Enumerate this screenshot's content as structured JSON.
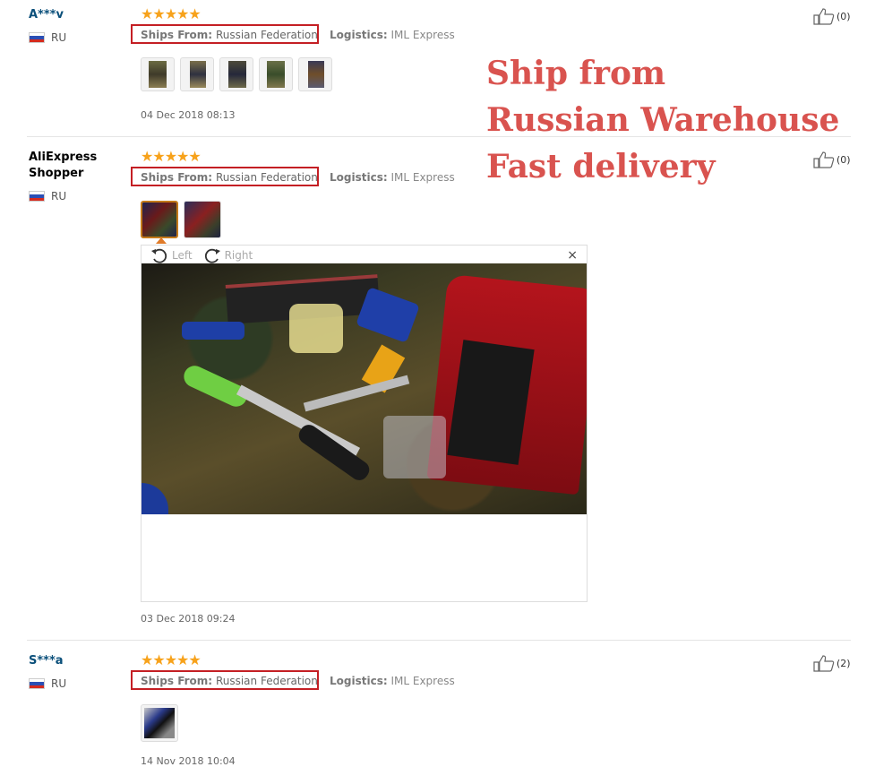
{
  "promo": {
    "line1": "Ship from",
    "line2": "Russian Warehouse",
    "line3": "Fast delivery"
  },
  "labels": {
    "ships_from": "Ships From:",
    "logistics": "Logistics:"
  },
  "viewer": {
    "rotate_left": "Left",
    "rotate_right": "Right",
    "close": "×"
  },
  "reviews": [
    {
      "user": "A***v",
      "country": "RU",
      "stars": "★★★★★",
      "ships_from": "Russian Federation",
      "logistics": "IML Express",
      "likes": "(0)",
      "date": "04 Dec 2018 08:13",
      "photo_count": 5
    },
    {
      "user": "AliExpress Shopper",
      "country": "RU",
      "stars": "★★★★★",
      "ships_from": "Russian Federation",
      "logistics": "IML Express",
      "likes": "(0)",
      "date": "03 Dec 2018 09:24",
      "photo_count": 2
    },
    {
      "user": "S***a",
      "country": "RU",
      "stars": "★★★★★",
      "ships_from": "Russian Federation",
      "logistics": "IML Express",
      "likes": "(2)",
      "date": "14 Nov 2018 10:04",
      "photo_count": 1
    }
  ],
  "colors": {
    "accent_red": "#c41f24",
    "promo_red": "#d9534f",
    "star": "#f7a21b"
  }
}
